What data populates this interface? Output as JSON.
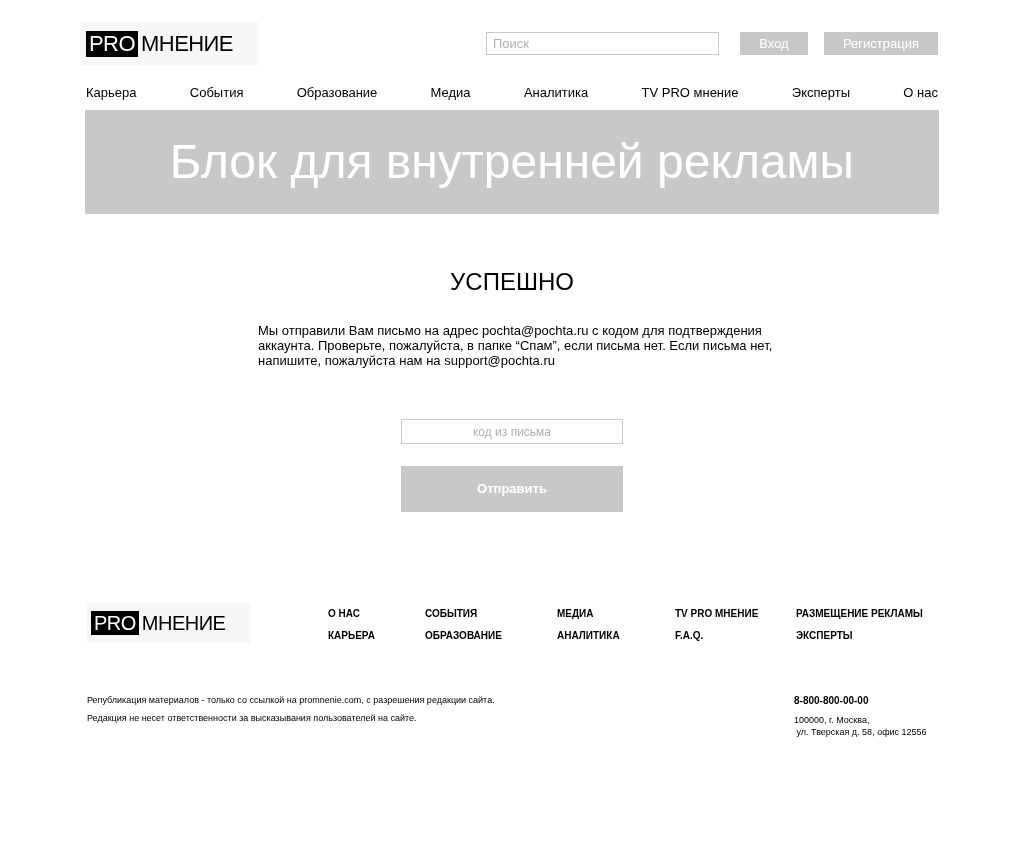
{
  "header": {
    "logo": {
      "badge": "PRO",
      "text": "МНЕНИЕ"
    },
    "search": {
      "placeholder": "Поиск"
    },
    "buttons": [
      "Вход",
      "Регистрация"
    ]
  },
  "nav": [
    "Карьера",
    "События",
    "Образование",
    "Медиа",
    "Аналитика",
    "TV PRO мнение",
    "Эксперты",
    "О нас"
  ],
  "banner": "Блок для внутренней рекламы",
  "main": {
    "title": "УСПЕШНО",
    "message": "Мы отправили Вам письмо на адрес pochta@pochta.ru с кодом для подтверждения аккаунта. Проверьте, пожалуйста, в папке “Спам”, если письма нет. Если письма нет, напишите, пожалуйста нам на support@pochta.ru",
    "code_field": {
      "placeholder": "код из письма"
    },
    "submit": "Отправить"
  },
  "footer": {
    "logo": {
      "badge": "PRO",
      "text": "МНЕНИЕ"
    },
    "columns": [
      [
        "О НАС",
        "КАРЬЕРА"
      ],
      [
        "СОБЫТИЯ",
        "ОБРАЗОВАНИЕ"
      ],
      [
        "МЕДИА",
        "АНАЛИТИКА"
      ],
      [
        "TV PRO МНЕНИЕ",
        "F.A.Q."
      ],
      [
        "РАЗМЕЩЕНИЕ РЕКЛАМЫ",
        "ЭКСПЕРТЫ"
      ]
    ],
    "legal": [
      "Републикация материалов - только со ссылкой на promnenie.com, с разрешения редакции сайта.",
      "Редакция не несет ответственности за высказывания пользователей на сайте."
    ],
    "phone": "8-800-800-00-00",
    "address": [
      "100000, г. Москва,",
      "ул. Тверская д. 58, офис 12556"
    ]
  }
}
